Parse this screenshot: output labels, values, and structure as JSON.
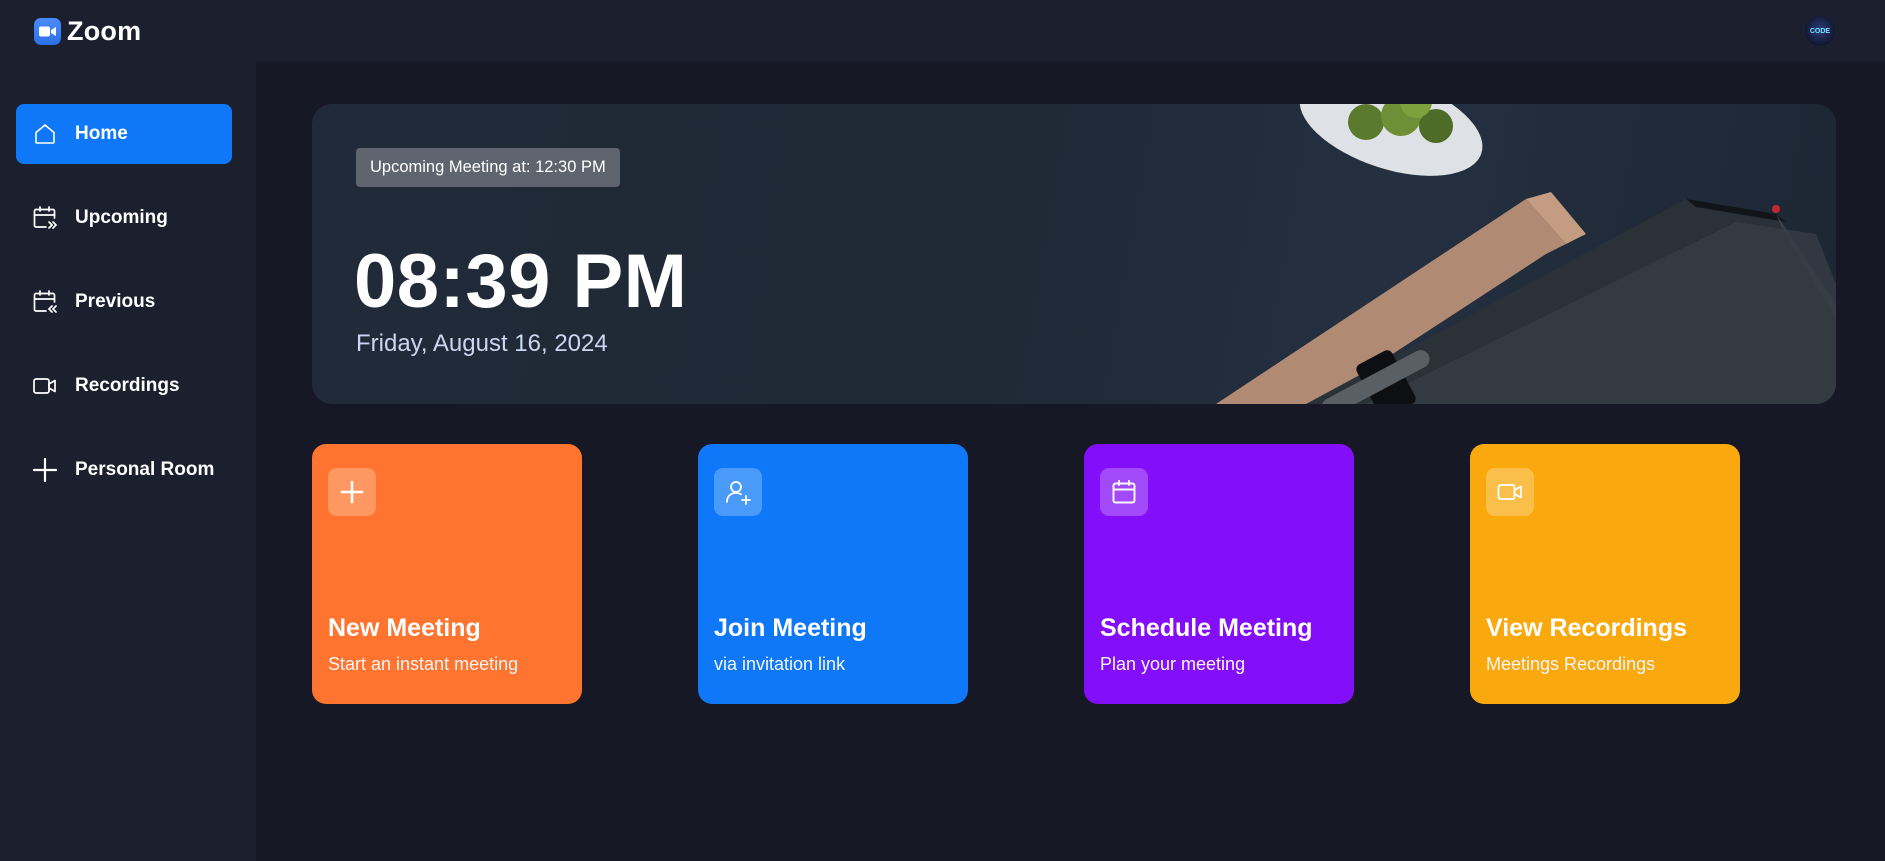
{
  "app": {
    "name": "Zoom",
    "accent": "#0e78f9",
    "avatar_text": "CODE"
  },
  "sidebar": {
    "items": [
      {
        "label": "Home",
        "icon": "home-icon",
        "active": true
      },
      {
        "label": "Upcoming",
        "icon": "calendar-upcoming-icon",
        "active": false
      },
      {
        "label": "Previous",
        "icon": "calendar-previous-icon",
        "active": false
      },
      {
        "label": "Recordings",
        "icon": "video-icon",
        "active": false
      },
      {
        "label": "Personal Room",
        "icon": "plus-icon",
        "active": false
      }
    ]
  },
  "hero": {
    "badge": "Upcoming Meeting at: 12:30 PM",
    "time": "08:39 PM",
    "date": "Friday, August 16, 2024"
  },
  "cards": [
    {
      "title": "New Meeting",
      "subtitle": "Start an instant meeting",
      "icon": "plus-icon",
      "color": "#ff742e"
    },
    {
      "title": "Join Meeting",
      "subtitle": "via invitation link",
      "icon": "user-plus-icon",
      "color": "#0e78f9"
    },
    {
      "title": "Schedule Meeting",
      "subtitle": "Plan your meeting",
      "icon": "calendar-icon",
      "color": "#830ef9"
    },
    {
      "title": "View Recordings",
      "subtitle": "Meetings Recordings",
      "icon": "video-icon",
      "color": "#f9a90e"
    }
  ]
}
